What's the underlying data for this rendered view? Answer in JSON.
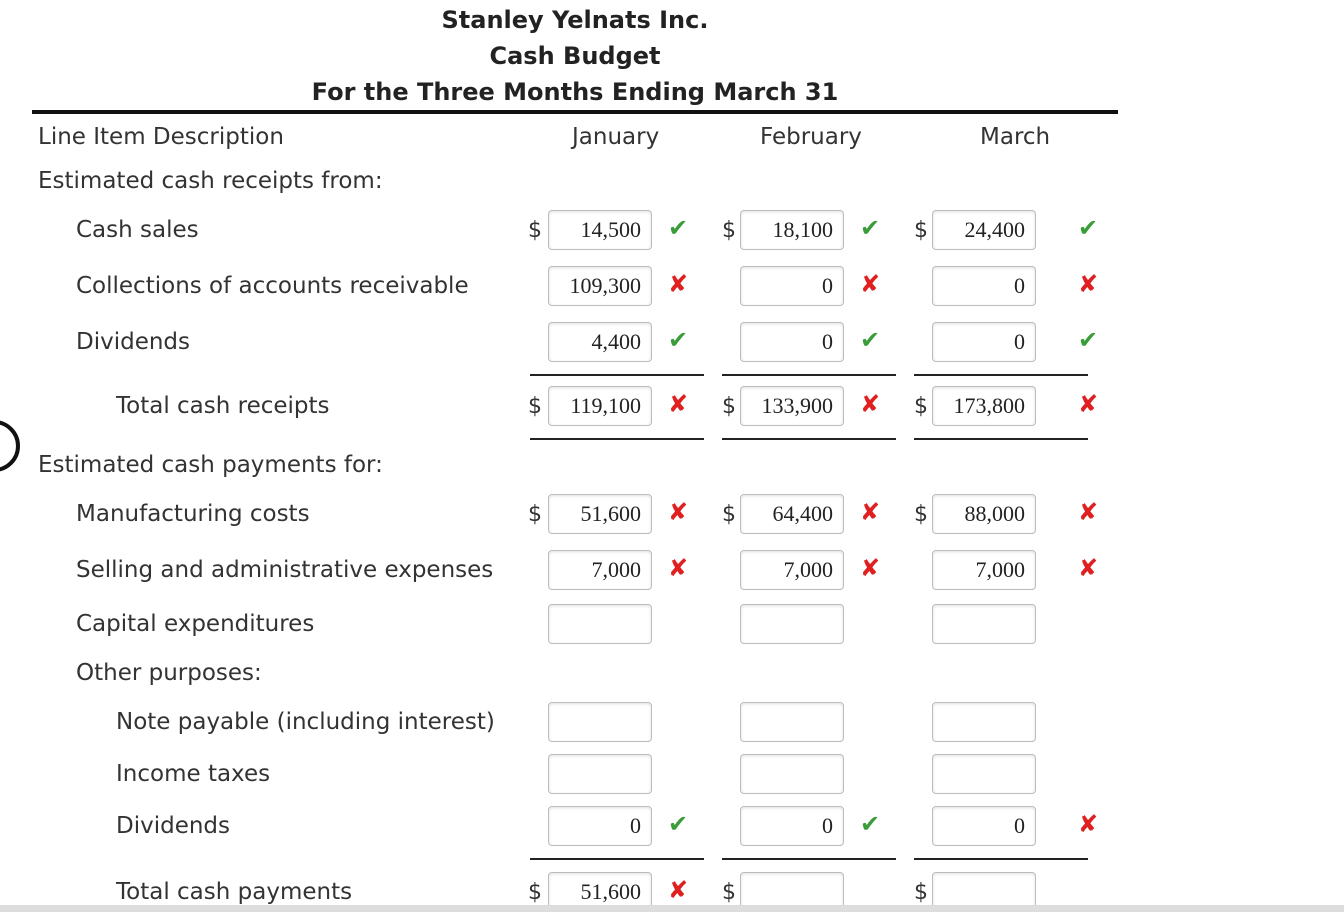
{
  "header": {
    "company": "Stanley Yelnats Inc.",
    "title": "Cash Budget",
    "period": "For the Three Months Ending March 31"
  },
  "columns": {
    "description": "Line Item Description",
    "jan": "January",
    "feb": "February",
    "mar": "March"
  },
  "sections": {
    "receipts": "Estimated cash receipts from:",
    "payments": "Estimated cash payments for:",
    "other": "Other purposes:"
  },
  "currency": "$",
  "colors": {
    "correct": "#3a9d3a",
    "incorrect": "#e02020"
  },
  "rows": {
    "cash_sales": {
      "label": "Cash sales",
      "jan": "14,500",
      "feb": "18,100",
      "mar": "24,400",
      "jan_mark": "correct",
      "feb_mark": "correct",
      "mar_mark": "correct"
    },
    "collections": {
      "label": "Collections of accounts receivable",
      "jan": "109,300",
      "feb": "0",
      "mar": "0",
      "jan_mark": "incorrect",
      "feb_mark": "incorrect",
      "mar_mark": "incorrect"
    },
    "dividends_r": {
      "label": "Dividends",
      "jan": "4,400",
      "feb": "0",
      "mar": "0",
      "jan_mark": "correct",
      "feb_mark": "correct",
      "mar_mark": "correct"
    },
    "total_receipts": {
      "label": "Total cash receipts",
      "jan": "119,100",
      "feb": "133,900",
      "mar": "173,800",
      "jan_mark": "incorrect",
      "feb_mark": "incorrect",
      "mar_mark": "incorrect"
    },
    "manufacturing": {
      "label": "Manufacturing costs",
      "jan": "51,600",
      "feb": "64,400",
      "mar": "88,000",
      "jan_mark": "incorrect",
      "feb_mark": "incorrect",
      "mar_mark": "incorrect"
    },
    "selling": {
      "label": "Selling and administrative expenses",
      "jan": "7,000",
      "feb": "7,000",
      "mar": "7,000",
      "jan_mark": "incorrect",
      "feb_mark": "incorrect",
      "mar_mark": "incorrect"
    },
    "capital": {
      "label": "Capital expenditures",
      "jan": "",
      "feb": "",
      "mar": ""
    },
    "note_payable": {
      "label": "Note payable (including interest)",
      "jan": "",
      "feb": "",
      "mar": ""
    },
    "income_taxes": {
      "label": "Income taxes",
      "jan": "",
      "feb": "",
      "mar": ""
    },
    "dividends_p": {
      "label": "Dividends",
      "jan": "0",
      "feb": "0",
      "mar": "0",
      "jan_mark": "correct",
      "feb_mark": "correct",
      "mar_mark": "incorrect"
    },
    "total_payments": {
      "label": "Total cash payments",
      "jan": "51,600",
      "feb": "",
      "mar": "",
      "jan_mark": "incorrect"
    }
  }
}
